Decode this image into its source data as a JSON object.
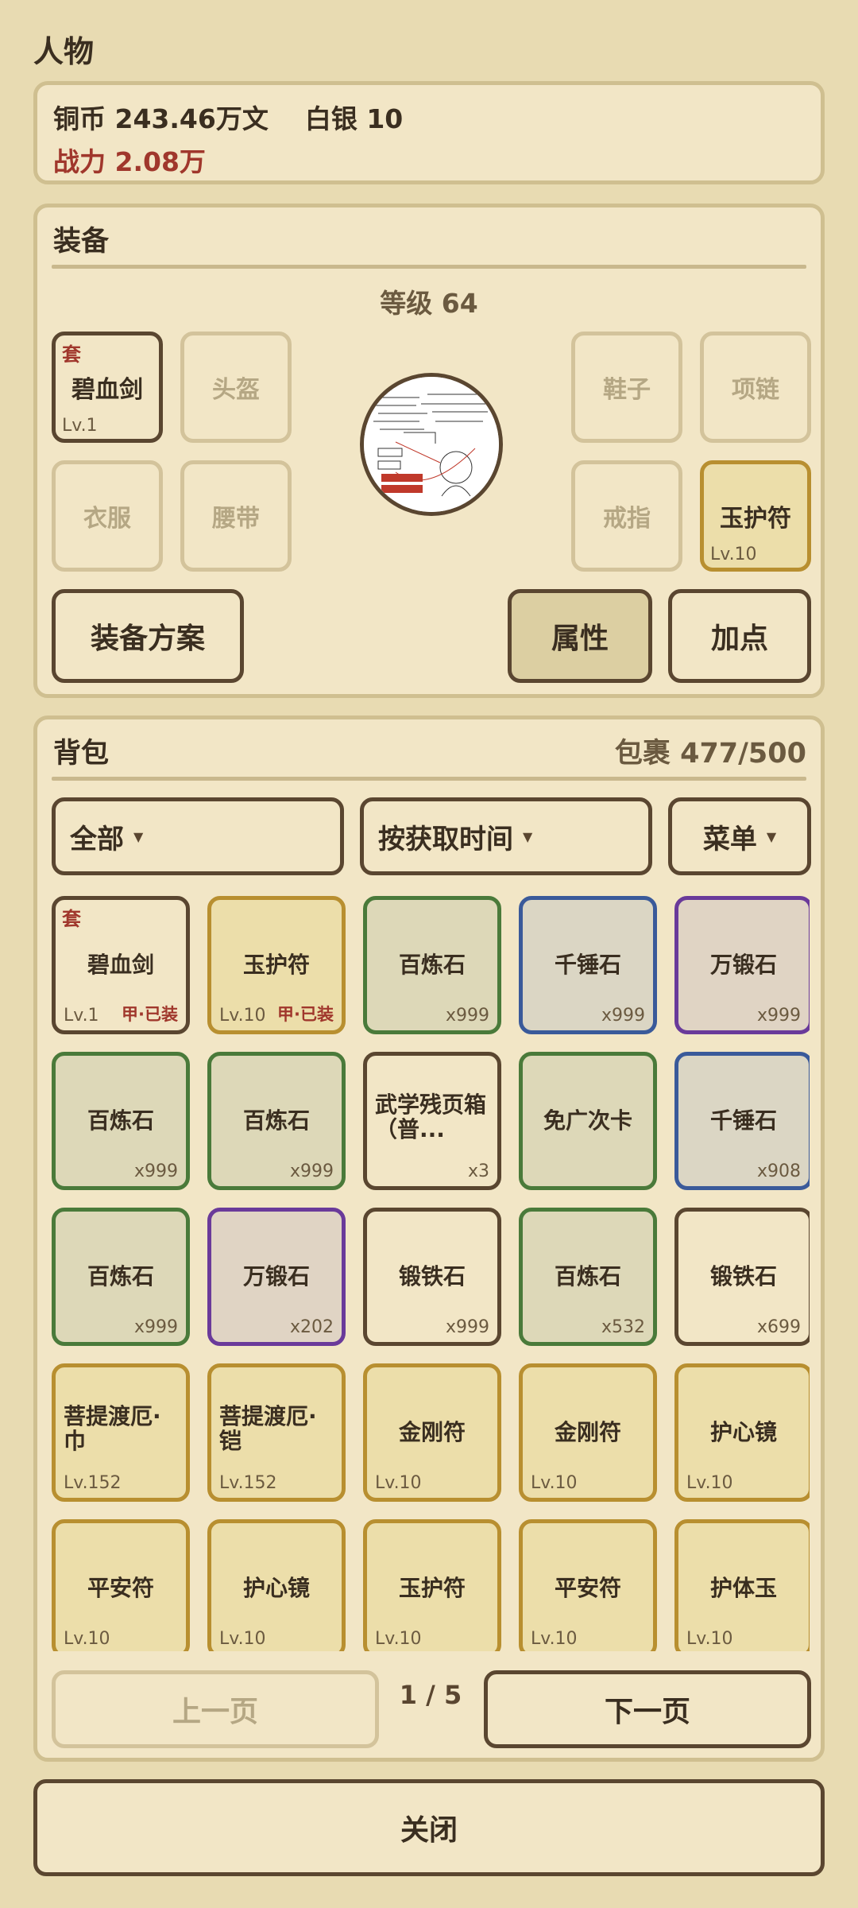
{
  "page_title": "人物",
  "currency": {
    "copper": "铜币 243.46万文",
    "silver": "白银 10",
    "power": "战力 2.08万"
  },
  "equipment": {
    "title": "装备",
    "level": "等级 64",
    "slots": {
      "weapon": {
        "tag": "套",
        "name": "碧血剑",
        "lv": "Lv.1"
      },
      "helmet": {
        "name": "头盔"
      },
      "clothes": {
        "name": "衣服"
      },
      "belt": {
        "name": "腰带"
      },
      "shoes": {
        "name": "鞋子"
      },
      "necklace": {
        "name": "项链"
      },
      "ring": {
        "name": "戒指"
      },
      "amulet": {
        "name": "玉护符",
        "lv": "Lv.10"
      }
    },
    "buttons": {
      "preset": "装备方案",
      "attributes": "属性",
      "addpoints": "加点"
    }
  },
  "bag": {
    "title": "背包",
    "capacity": "包裹 477/500",
    "filter": "全部",
    "sort": "按获取时间",
    "menu": "菜单",
    "items": [
      {
        "name": "碧血剑",
        "tag": "套",
        "lv": "Lv.1",
        "equipped": "甲·已装",
        "rarity": "white"
      },
      {
        "name": "玉护符",
        "lv": "Lv.10",
        "equipped": "甲·已装",
        "rarity": "gold"
      },
      {
        "name": "百炼石",
        "qty": "x999",
        "rarity": "green"
      },
      {
        "name": "千锤石",
        "qty": "x999",
        "rarity": "blue"
      },
      {
        "name": "万锻石",
        "qty": "x999",
        "rarity": "purple"
      },
      {
        "name": "百炼石",
        "qty": "x999",
        "rarity": "green"
      },
      {
        "name": "百炼石",
        "qty": "x999",
        "rarity": "green"
      },
      {
        "name": "武学残页箱（普...",
        "qty": "x3",
        "rarity": "white",
        "align": "left"
      },
      {
        "name": "免广次卡",
        "rarity": "green"
      },
      {
        "name": "千锤石",
        "qty": "x908",
        "rarity": "blue"
      },
      {
        "name": "百炼石",
        "qty": "x999",
        "rarity": "green"
      },
      {
        "name": "万锻石",
        "qty": "x202",
        "rarity": "purple"
      },
      {
        "name": "锻铁石",
        "qty": "x999",
        "rarity": "white"
      },
      {
        "name": "百炼石",
        "qty": "x532",
        "rarity": "green"
      },
      {
        "name": "锻铁石",
        "qty": "x699",
        "rarity": "white"
      },
      {
        "name": "菩提渡厄·巾",
        "lv": "Lv.152",
        "rarity": "gold",
        "align": "left"
      },
      {
        "name": "菩提渡厄·铠",
        "lv": "Lv.152",
        "rarity": "gold",
        "align": "left"
      },
      {
        "name": "金刚符",
        "lv": "Lv.10",
        "rarity": "gold"
      },
      {
        "name": "金刚符",
        "lv": "Lv.10",
        "rarity": "gold"
      },
      {
        "name": "护心镜",
        "lv": "Lv.10",
        "rarity": "gold"
      },
      {
        "name": "平安符",
        "lv": "Lv.10",
        "rarity": "gold"
      },
      {
        "name": "护心镜",
        "lv": "Lv.10",
        "rarity": "gold"
      },
      {
        "name": "玉护符",
        "lv": "Lv.10",
        "rarity": "gold"
      },
      {
        "name": "平安符",
        "lv": "Lv.10",
        "rarity": "gold"
      },
      {
        "name": "护体玉",
        "lv": "Lv.10",
        "rarity": "gold"
      }
    ],
    "pagination": {
      "prev": "上一页",
      "indicator": "1 / 5",
      "next": "下一页"
    }
  },
  "close": "关闭"
}
